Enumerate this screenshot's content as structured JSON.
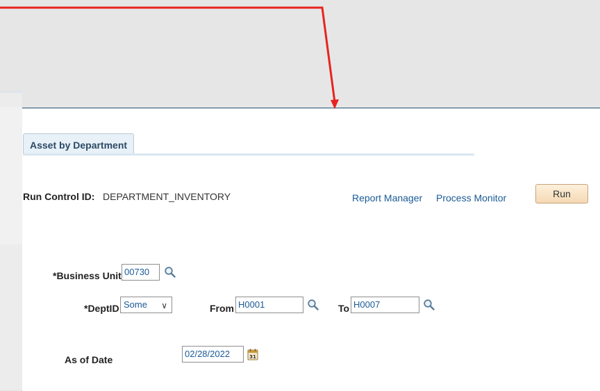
{
  "tab": {
    "label": "Asset by Department"
  },
  "run_control": {
    "label": "Run Control ID:",
    "value": "DEPARTMENT_INVENTORY"
  },
  "links": {
    "report_manager": "Report Manager",
    "process_monitor": "Process Monitor"
  },
  "run_button": "Run",
  "form": {
    "business_unit": {
      "label": "*Business Unit",
      "value": "00730"
    },
    "deptid": {
      "label": "*DeptID",
      "selected": "Some",
      "from_label": "From",
      "from_value": "H0001",
      "to_label": "To",
      "to_value": "H0007"
    },
    "as_of_date": {
      "label": "As of Date",
      "value": "02/28/2022"
    }
  },
  "icons": {
    "lookup": "magnifier-icon",
    "calendar": "calendar-icon"
  },
  "colors": {
    "annotation_arrow": "#e8231f",
    "link": "#1a5a96",
    "header_border": "#24506f"
  }
}
